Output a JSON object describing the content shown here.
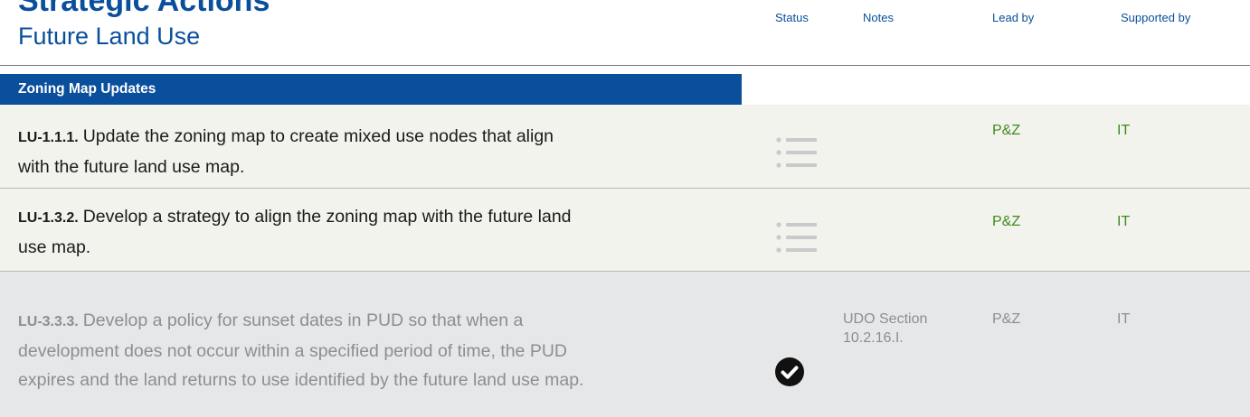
{
  "header": {
    "title": "Strategic Actions",
    "subtitle": "Future Land Use",
    "columns": {
      "status": "Status",
      "notes": "Notes",
      "lead": "Lead by",
      "supported": "Supported by"
    }
  },
  "section": {
    "title": "Zoning Map Updates"
  },
  "rows": [
    {
      "code": "LU-1.1.1.",
      "text_line1": "Update the zoning map to create mixed use nodes that align",
      "text_line2": "with the future land use map.",
      "status_icon": "in-progress-list-icon",
      "notes": "",
      "lead": "P&Z",
      "supported": "IT"
    },
    {
      "code": "LU-1.3.2.",
      "text_line1": "Develop a strategy to align the zoning map with the future land",
      "text_line2": "use map.",
      "status_icon": "in-progress-list-icon",
      "notes": "",
      "lead": "P&Z",
      "supported": "IT"
    },
    {
      "code": "LU-3.3.3.",
      "text_line1": "Develop a policy for sunset dates in PUD so that when a",
      "text_line2": "development does not occur within a specified period of time, the PUD",
      "text_line3": "expires and the land returns to use identified by the future land use map.",
      "status_icon": "completed-check-icon",
      "notes_line1": "UDO Section",
      "notes_line2": "10.2.16.I.",
      "lead": "P&Z",
      "supported": "IT"
    }
  ],
  "colors": {
    "brand_blue": "#0a4f9c",
    "active_green": "#3f8a1f",
    "active_row_bg": "#f2f3ec",
    "done_row_bg": "#e6e7e9",
    "done_text": "#8e8e8e"
  }
}
